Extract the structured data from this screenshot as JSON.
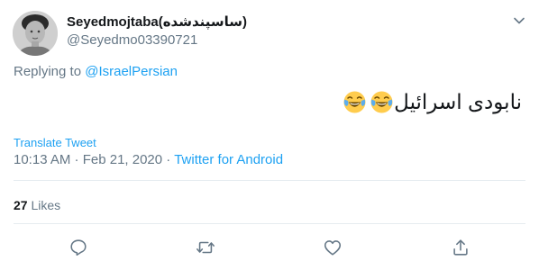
{
  "tweet": {
    "display_name": "Seyedmojtaba(ساسپندشده)",
    "handle": "@Seyedmo03390721",
    "replying_prefix": "Replying to",
    "replying_to": "@IsraelPersian",
    "text": "نابودی اسرائیل",
    "translate_label": "Translate Tweet",
    "timestamp": "10:13 AM · Feb 21, 2020",
    "separator": " · ",
    "source": "Twitter for Android",
    "likes_count": "27",
    "likes_label": "Likes"
  },
  "icons": {
    "menu": "chevron-down-icon",
    "reply": "reply-icon",
    "retweet": "retweet-icon",
    "like": "heart-icon",
    "share": "share-icon",
    "emoji": "face-with-tears-of-joy-icon"
  },
  "colors": {
    "link": "#1da1f2",
    "muted": "#657786",
    "text": "#14171a",
    "divider": "#e6ecf0"
  }
}
